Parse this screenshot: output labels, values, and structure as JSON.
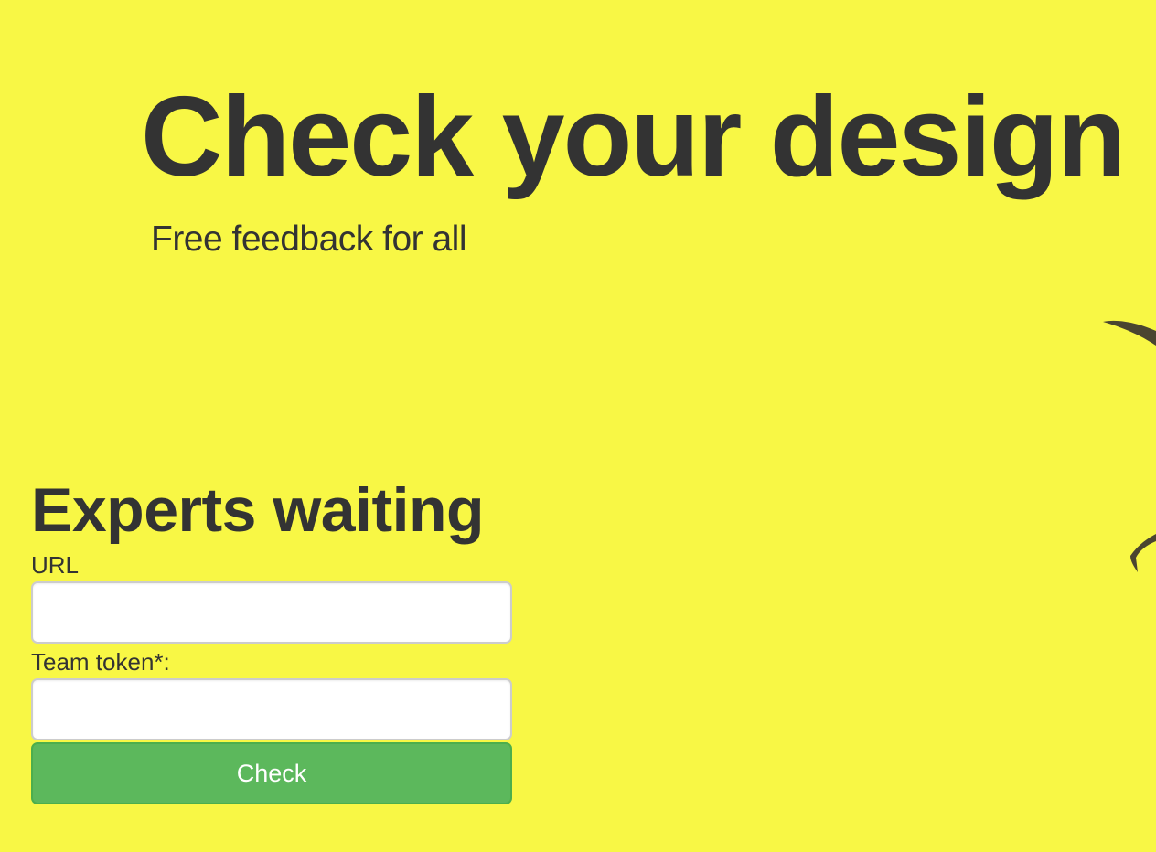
{
  "hero": {
    "title": "Check your design",
    "subtitle": "Free feedback for all"
  },
  "form": {
    "heading": "Experts waiting",
    "url_label": "URL",
    "url_value": "",
    "token_label": "Team token*:",
    "token_value": "",
    "submit_label": "Check"
  },
  "colors": {
    "background": "#f8f745",
    "text": "#333333",
    "button": "#5cb85c"
  }
}
